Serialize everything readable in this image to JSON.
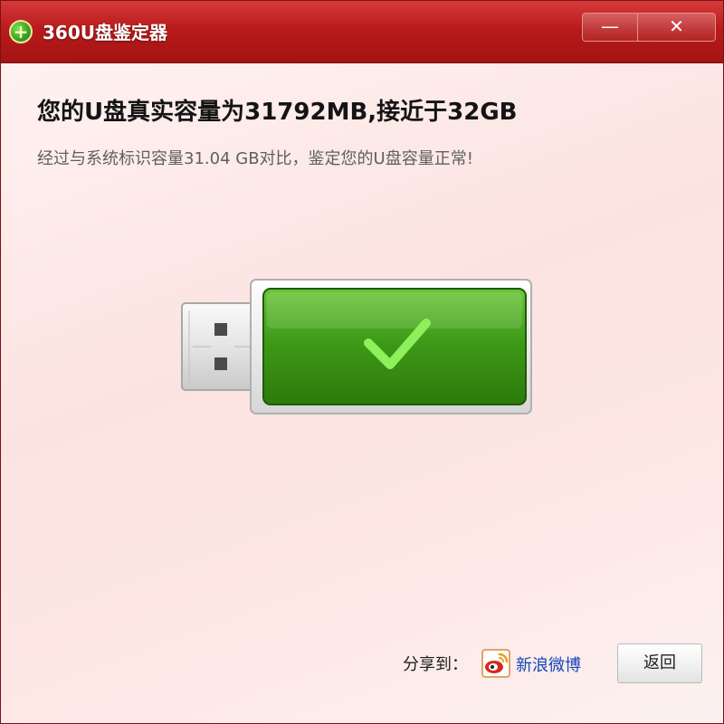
{
  "window": {
    "title": "360U盘鉴定器",
    "minimize_label": "—",
    "close_label": "✕"
  },
  "result": {
    "heading": "您的U盘真实容量为31792MB,接近于32GB",
    "detail": "经过与系统标识容量31.04 GB对比，鉴定您的U盘容量正常!"
  },
  "footer": {
    "share_label": "分享到：",
    "weibo_label": "新浪微博",
    "back_label": "返回"
  },
  "icons": {
    "logo": "plus-circle-logo",
    "status": "check-icon",
    "share": "weibo-icon"
  },
  "colors": {
    "titlebar": "#b81b1b",
    "status_green": "#3f9a18",
    "link": "#1747b9"
  }
}
